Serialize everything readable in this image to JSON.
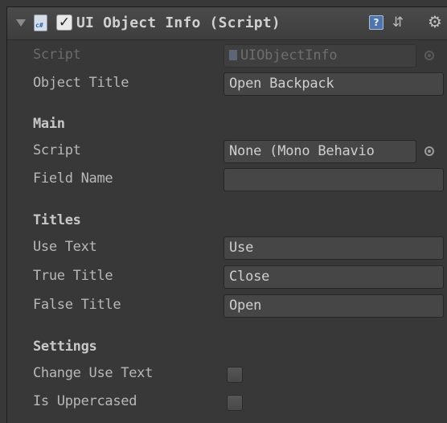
{
  "header": {
    "title": "UI Object Info (Script)",
    "enabled": true,
    "icons": [
      "foldout-arrow-icon",
      "csharp-script-icon",
      "help-icon",
      "preset-icon",
      "gear-icon"
    ]
  },
  "fields": {
    "script": {
      "label": "Script",
      "value": "UIObjectInfo"
    },
    "object_title": {
      "label": "Object Title",
      "value": "Open Backpack"
    }
  },
  "sections": {
    "main": {
      "title": "Main",
      "script": {
        "label": "Script",
        "value": "None (Mono Behavio"
      },
      "field_name": {
        "label": "Field Name",
        "value": ""
      }
    },
    "titles": {
      "title": "Titles",
      "use_text": {
        "label": "Use Text",
        "value": "Use"
      },
      "true_title": {
        "label": "True Title",
        "value": "Close"
      },
      "false_title": {
        "label": "False Title",
        "value": "Open"
      }
    },
    "settings": {
      "title": "Settings",
      "change_use_text": {
        "label": "Change Use Text",
        "checked": false
      },
      "is_uppercased": {
        "label": "Is Uppercased",
        "checked": false
      }
    }
  },
  "colors": {
    "background": "#383838",
    "field_background": "#464646",
    "text": "#b8b8b8"
  }
}
